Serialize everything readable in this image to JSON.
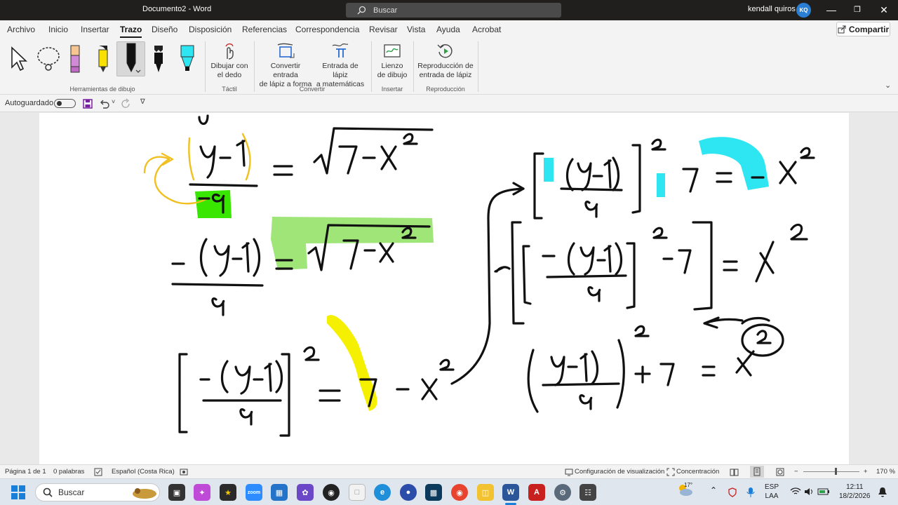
{
  "window": {
    "doc_name": "Documento2",
    "separator": "-",
    "app_name": "Word",
    "search_placeholder": "Buscar",
    "user_name": "kendall quiros",
    "user_initials": "KQ"
  },
  "menu": {
    "tabs": [
      "Archivo",
      "Inicio",
      "Insertar",
      "Trazo",
      "Diseño",
      "Disposición",
      "Referencias",
      "Correspondencia",
      "Revisar",
      "Vista",
      "Ayuda",
      "Acrobat"
    ],
    "active": "Trazo",
    "share_label": "Compartir"
  },
  "ribbon": {
    "groups": {
      "drawing_tools": "Herramientas de dibujo",
      "touch": "Táctil",
      "convert": "Convertir",
      "insert": "Insertar",
      "playback": "Reproducción"
    },
    "buttons": {
      "draw_finger_l1": "Dibujar con",
      "draw_finger_l2": "el dedo",
      "ink_shape_l1": "Convertir entrada",
      "ink_shape_l2": "de lápiz a forma",
      "ink_math_l1": "Entrada de lápiz",
      "ink_math_l2": "a matemáticas",
      "canvas_l1": "Lienzo",
      "canvas_l2": "de dibujo",
      "replay_l1": "Reproducción de",
      "replay_l2": "entrada de lápiz"
    }
  },
  "qat": {
    "autosave_label": "Autoguardado"
  },
  "status": {
    "page": "Página 1 de 1",
    "words": "0 palabras",
    "language": "Español (Costa Rica)",
    "display_settings": "Configuración de visualización",
    "focus": "Concentración",
    "zoom_minus": "−",
    "zoom_plus": "+",
    "zoom": "170 %"
  },
  "taskbar": {
    "search_placeholder": "Buscar",
    "lang_l1": "ESP",
    "lang_l2": "LAA",
    "time": "12:11",
    "date": "18/2/2026",
    "weather": "17°"
  },
  "colors": {
    "titlebar": "#201f1e",
    "ribbon": "#f3f3f3",
    "highlight_green": "#39e600",
    "highlight_yellow": "#f5f000",
    "highlight_cyan": "#2ee6f2",
    "ink_orange": "#f0c020"
  }
}
